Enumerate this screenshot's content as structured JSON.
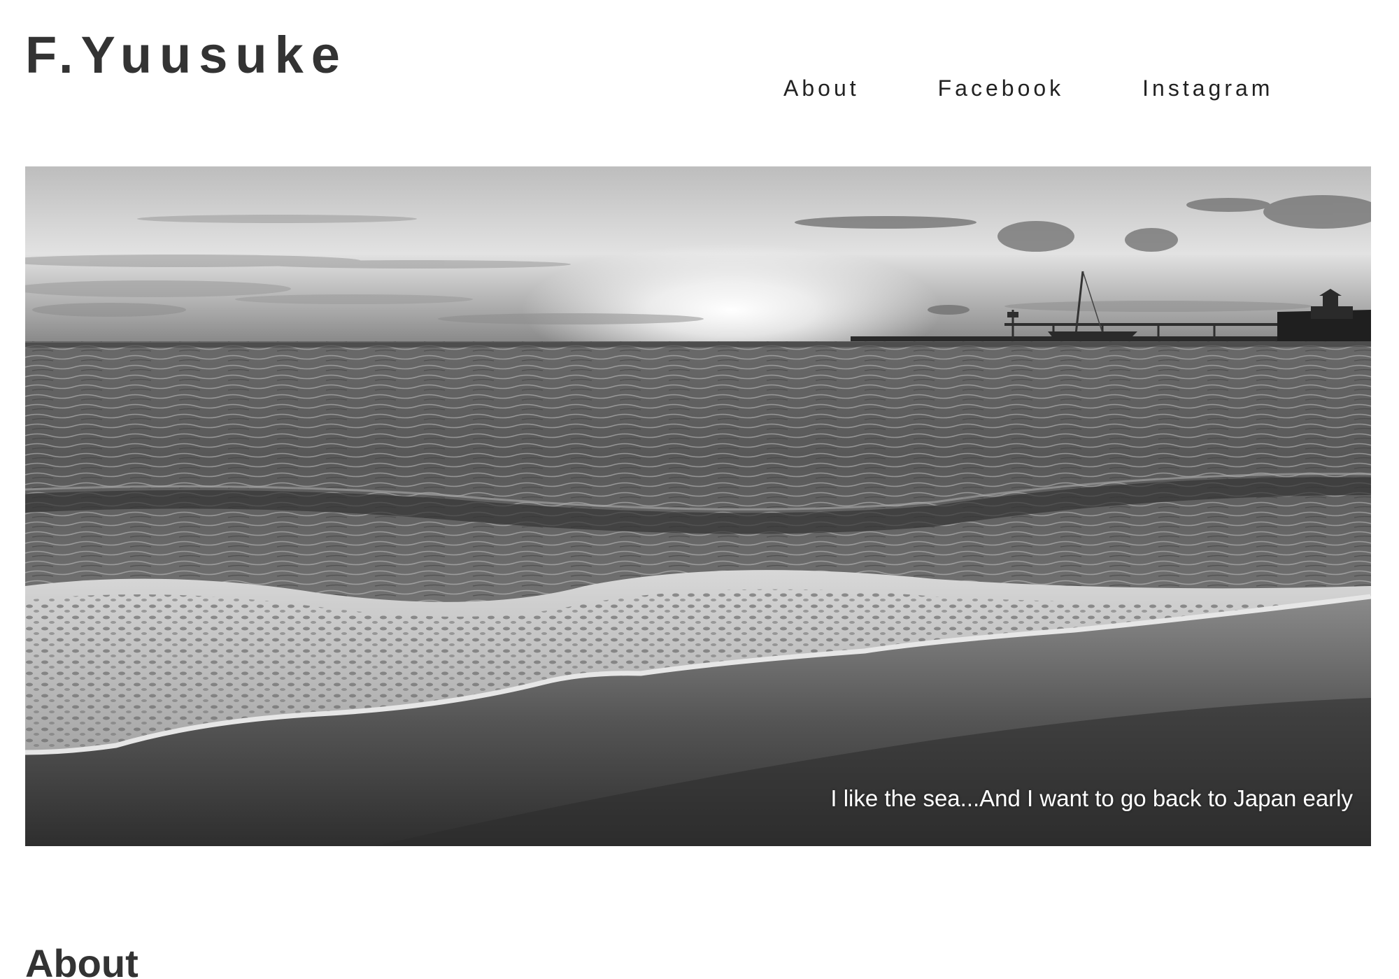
{
  "header": {
    "site_title": "F.Yuusuke",
    "nav": [
      {
        "label": "About"
      },
      {
        "label": "Facebook"
      },
      {
        "label": "Instagram"
      }
    ]
  },
  "hero": {
    "caption": "I like the sea...And I want to go back to Japan early",
    "image": "black-and-white photo of waves on a beach at sunset with a pier on the horizon"
  },
  "sections": {
    "about_heading": "About"
  },
  "colors": {
    "text": "#333333",
    "background": "#ffffff",
    "caption": "#ffffff"
  }
}
